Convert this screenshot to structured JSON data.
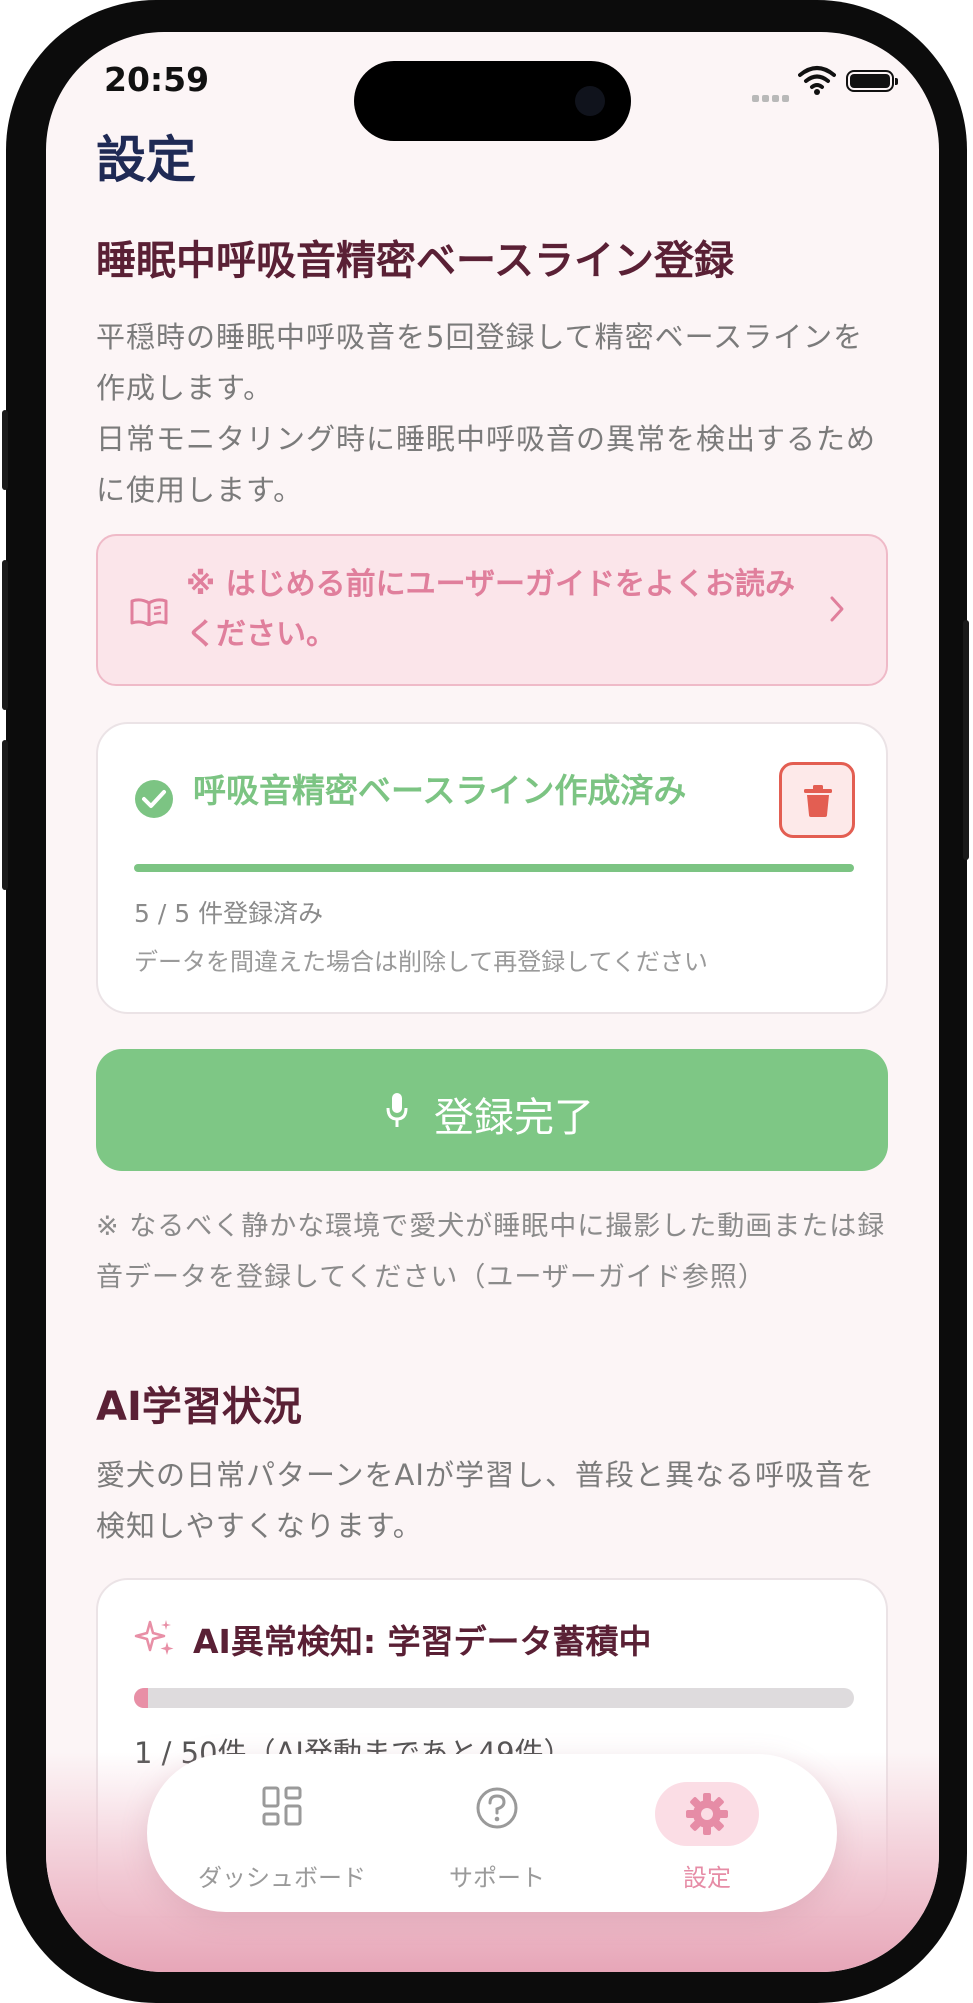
{
  "status_bar": {
    "time": "20:59"
  },
  "header": {
    "title": "設定"
  },
  "baseline_section": {
    "heading": "睡眠中呼吸音精密ベースライン登録",
    "description_1": "平穏時の睡眠中呼吸音を5回登録して精密ベースラインを作成します。",
    "description_2": "日常モニタリング時に睡眠中呼吸音の異常を検出するために使用します。",
    "guide_notice": "※ はじめる前にユーザーガイドをよくお読みください。",
    "status_card": {
      "status_label": "呼吸音精密ベースライン作成済み",
      "progress_fraction": 1.0,
      "count_text": "5 / 5 件登録済み",
      "hint": "データを間違えた場合は削除して再登録してください"
    },
    "register_button_label": "登録完了",
    "footnote": "※ なるべく静かな環境で愛犬が睡眠中に撮影した動画または録音データを登録してください（ユーザーガイド参照）"
  },
  "ai_section": {
    "heading": "AI学習状況",
    "description": "愛犬の日常パターンをAIが学習し、普段と異なる呼吸音を検知しやすくなります。",
    "card": {
      "title": "AI異常検知: 学習データ蓄積中",
      "progress_fraction": 0.02,
      "count_text": "1 / 50件（AI発動まであと49件）"
    }
  },
  "tab_bar": {
    "tabs": [
      {
        "label": "ダッシュボード",
        "icon": "grid-icon",
        "active": false
      },
      {
        "label": "サポート",
        "icon": "question-circle-icon",
        "active": false
      },
      {
        "label": "設定",
        "icon": "gear-icon",
        "active": true
      }
    ]
  },
  "colors": {
    "accent_pink": "#e68ca6",
    "success_green": "#7cc483",
    "danger_red": "#e35e52",
    "heading": "#5a2035"
  }
}
